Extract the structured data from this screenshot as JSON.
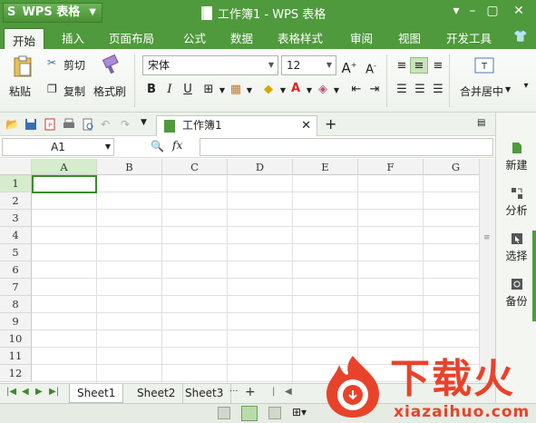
{
  "app": {
    "brand": "WPS 表格",
    "doc_title": "工作簿1 - WPS 表格",
    "window_controls": [
      "minimize",
      "restore",
      "close"
    ]
  },
  "menu": [
    "开始",
    "插入",
    "页面布局",
    "公式",
    "数据",
    "表格样式",
    "审阅",
    "视图",
    "开发工具"
  ],
  "ribbon": {
    "paste": "粘贴",
    "cut": "剪切",
    "copy": "复制",
    "format_painter": "格式刷",
    "font_name": "宋体",
    "font_size": "12",
    "merge_center": "合并居中"
  },
  "doc_tab": "工作簿1",
  "formula_bar": {
    "name_box": "A1",
    "fx_label": "fx",
    "value": ""
  },
  "grid": {
    "columns": [
      "A",
      "B",
      "C",
      "D",
      "E",
      "F",
      "G"
    ],
    "rows": [
      "1",
      "2",
      "3",
      "4",
      "5",
      "6",
      "7",
      "8",
      "9",
      "10",
      "11",
      "12"
    ],
    "active_cell": "A1"
  },
  "sheets": [
    "Sheet1",
    "Sheet2",
    "Sheet3"
  ],
  "sheet_more": "···",
  "sheet_add": "+",
  "task_pane": [
    "新建",
    "分析",
    "选择",
    "备份"
  ],
  "watermark": {
    "brand": "下载火",
    "url": "xiazaihuo.com"
  },
  "colors": {
    "accent": "#4f9a3c",
    "selection": "#d6eccc",
    "watermark": "#e8432a"
  }
}
